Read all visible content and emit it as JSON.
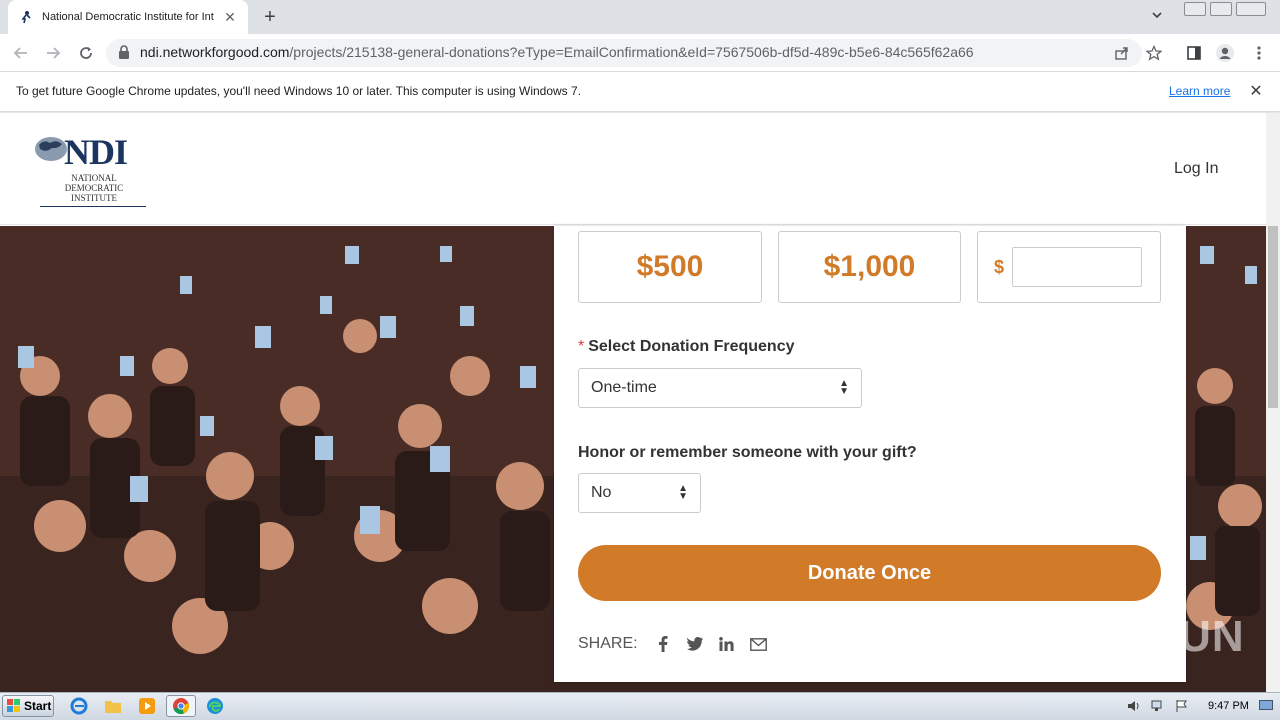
{
  "browser": {
    "tab_title": "National Democratic Institute for Int",
    "url_host": "ndi.networkforgood.com",
    "url_path": "/projects/215138-general-donations?eType=EmailConfirmation&eId=7567506b-df5d-489c-b5e6-84c565f62a66"
  },
  "infobar": {
    "message": "To get future Google Chrome updates, you'll need Windows 10 or later. This computer is using Windows 7.",
    "learn_more": "Learn more"
  },
  "header": {
    "logo_big": "NDI",
    "logo_small": "NATIONAL DEMOCRATIC INSTITUTE",
    "login": "Log In"
  },
  "form": {
    "amounts": [
      "$500",
      "$1,000"
    ],
    "currency_symbol": "$",
    "other_amount_value": "",
    "frequency_label": "Select Donation Frequency",
    "frequency_required_mark": "*",
    "frequency_value": "One-time",
    "honor_label": "Honor or remember someone with your gift?",
    "honor_value": "No",
    "donate_button": "Donate Once",
    "share_label": "SHARE:"
  },
  "watermark": "ANY RUN",
  "taskbar": {
    "start_label": "Start",
    "clock": "9:47 PM"
  },
  "colors": {
    "accent": "#d17a28",
    "ndi_navy": "#1b3560"
  }
}
